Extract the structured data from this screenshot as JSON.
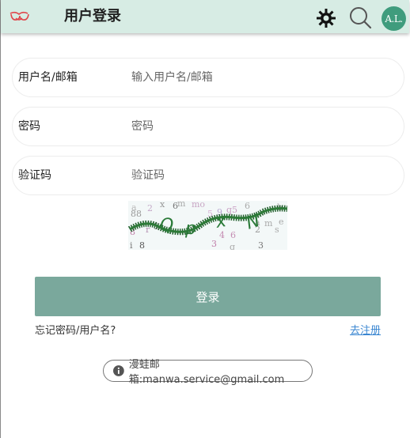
{
  "header": {
    "title": "用户登录",
    "logo_icon": "manwa-logo-icon",
    "settings_icon": "gear-icon",
    "search_icon": "search-icon",
    "avatar_text": "A.L."
  },
  "form": {
    "username": {
      "label": "用户名/邮箱",
      "placeholder": "输入用户名/邮箱",
      "value": ""
    },
    "password": {
      "label": "密码",
      "placeholder": "密码",
      "value": ""
    },
    "captcha": {
      "label": "验证码",
      "placeholder": "验证码",
      "value": ""
    },
    "captcha_text": "QpxN"
  },
  "actions": {
    "login_label": "登录",
    "forgot_label": "忘记密码/用户名?",
    "register_label": "去注册"
  },
  "footer": {
    "contact_text": "漫蛙邮箱:manwa.service@gmail.com",
    "info_icon": "info-icon"
  },
  "colors": {
    "header_bg": "#d7ece4",
    "accent": "#7aa89c",
    "avatar_bg": "#3f9c7d",
    "link": "#3a86d1",
    "logo": "#e0454a"
  }
}
